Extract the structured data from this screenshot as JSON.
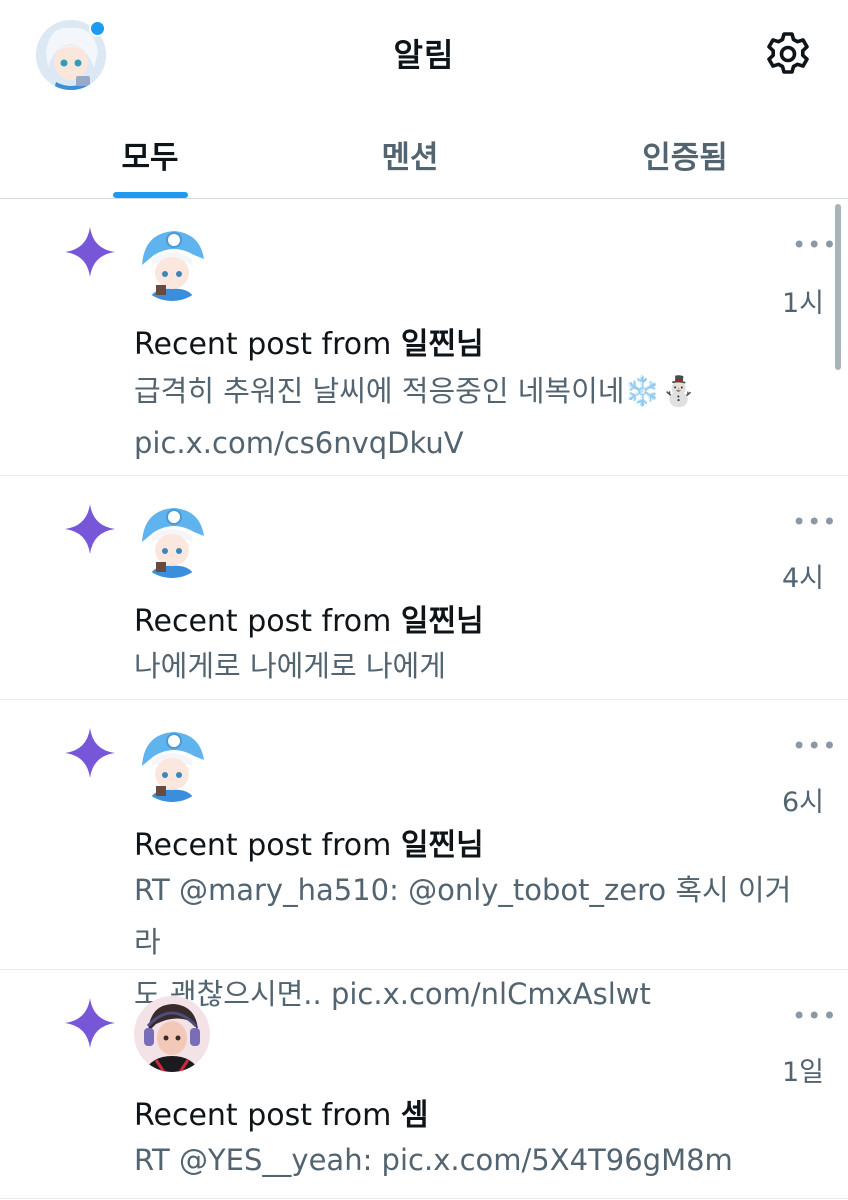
{
  "header": {
    "title": "알림",
    "icons": {
      "avatar": "user-avatar",
      "settings": "gear-icon"
    }
  },
  "tabs": [
    {
      "label": "모두",
      "active": true
    },
    {
      "label": "멘션",
      "active": false
    },
    {
      "label": "인증됨",
      "active": false
    }
  ],
  "notifications": [
    {
      "prefix": "Recent post from ",
      "name": "일찐님",
      "time": "1시",
      "more": "•••",
      "text": "급격히 추워진 날씨에 적응중인 네복이네❄️⛄",
      "text2": "pic.x.com/cs6nvqDkuV"
    },
    {
      "prefix": "Recent post from ",
      "name": "일찐님",
      "time": "4시",
      "more": "•••",
      "text": "나에게로 나에게로 나에게"
    },
    {
      "prefix": "Recent post from ",
      "name": "일찐님",
      "time": "6시",
      "more": "•••",
      "text": "RT @mary_ha510: @only_tobot_zero 혹시 이거라",
      "text2": "도 괜찮으시면.. pic.x.com/nlCmxAslwt"
    },
    {
      "prefix": "Recent post from ",
      "name": "셈",
      "time": "1일",
      "more": "•••",
      "text": "RT @YES__yeah: pic.x.com/5X4T96gM8m"
    }
  ],
  "colors": {
    "accent": "#1d9bf0",
    "sparkle": "#7856d8",
    "text": "#0f1419",
    "muted": "#536471"
  }
}
